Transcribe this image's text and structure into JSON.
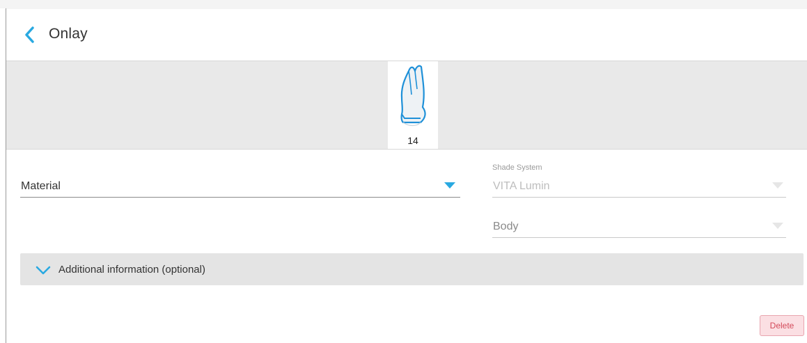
{
  "header": {
    "title": "Onlay"
  },
  "tooth": {
    "number": "14"
  },
  "form": {
    "material": {
      "value": "Material"
    },
    "shade_system": {
      "label": "Shade System",
      "value": "VITA Lumin"
    },
    "body": {
      "value": "Body"
    }
  },
  "additional": {
    "label": "Additional information (optional)"
  },
  "actions": {
    "delete_label": "Delete"
  },
  "colors": {
    "accent": "#29a9e1",
    "danger_bg": "#fbdfe3",
    "danger_text": "#d34a5a"
  }
}
